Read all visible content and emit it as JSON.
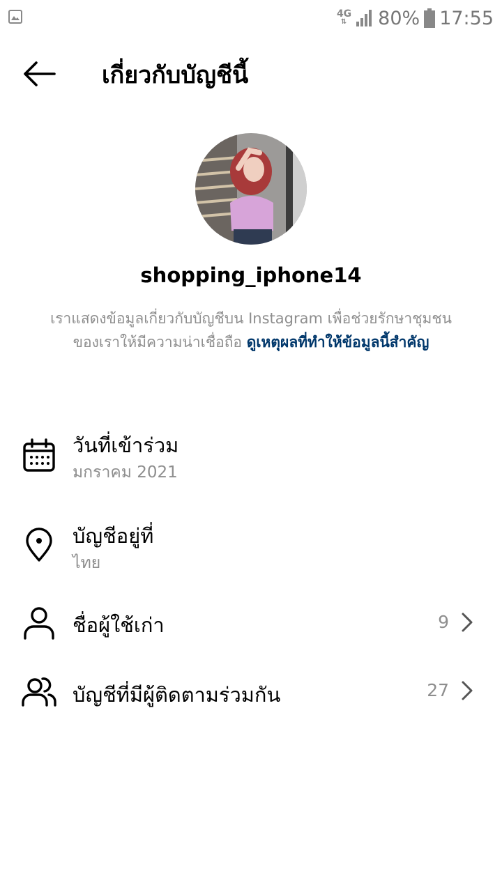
{
  "status_bar": {
    "network": "4G",
    "battery": "80%",
    "time": "17:55",
    "icons": [
      "gallery-icon",
      "signal-icon",
      "battery-icon"
    ]
  },
  "header": {
    "title": "เกี่ยวกับบัญชีนี้",
    "back_icon": "arrow-left-icon"
  },
  "profile": {
    "username": "shopping_iphone14",
    "info_text": "เราแสดงข้อมูลเกี่ยวกับบัญชีบน Instagram เพื่อช่วยรักษาชุมชนของเราให้มีความน่าเชื่อถือ",
    "info_link": "ดูเหตุผลที่ทำให้ข้อมูลนี้สำคัญ"
  },
  "details": {
    "date_joined": {
      "title": "วันที่เข้าร่วม",
      "value": "มกราคม 2021",
      "icon": "calendar-icon"
    },
    "account_based_in": {
      "title": "บัญชีอยู่ที่",
      "value": "ไทย",
      "icon": "location-pin-icon"
    },
    "former_usernames": {
      "title": "ชื่อผู้ใช้เก่า",
      "count": "9",
      "icon": "person-icon"
    },
    "mutual_followers": {
      "title": "บัญชีที่มีผู้ติดตามร่วมกัน",
      "count": "27",
      "icon": "people-icon"
    }
  },
  "colors": {
    "link": "#00376b",
    "secondary_text": "#8e8e8e",
    "primary_text": "#000000",
    "background": "#ffffff"
  }
}
